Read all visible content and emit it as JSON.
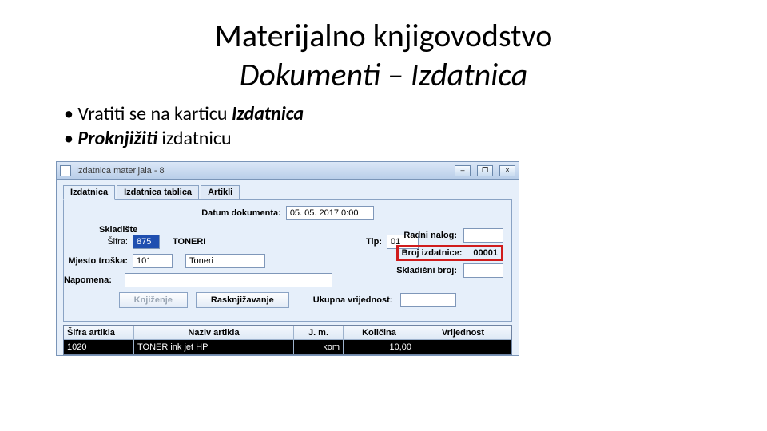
{
  "title": {
    "line1": "Materijalno knjigovodstvo",
    "line2": "Dokumenti – Izdatnica"
  },
  "bullets": {
    "b1_pre": "Vratiti se na karticu ",
    "b1_em": "Izdatnica",
    "b2_em": "Proknjižiti",
    "b2_post": " izdatnicu"
  },
  "app": {
    "window_title": "Izdatnica materijala - 8",
    "win_min": "–",
    "win_max": "❐",
    "win_close": "×",
    "tabs": {
      "t1": "Izdatnica",
      "t2": "Izdatnica tablica",
      "t3": "Artikli"
    },
    "fields": {
      "datum_lbl": "Datum dokumenta:",
      "datum_val": "05. 05. 2017 0:00",
      "skladiste_lbl": "Skladište",
      "sifra_lbl": "Šifra:",
      "sifra_val": "875",
      "sklad_name": "TONERI",
      "tip_lbl": "Tip:",
      "tip_val": "01",
      "mjesto_lbl": "Mjesto troška:",
      "mjesto_val": "101",
      "mjesto_name": "Toneri",
      "radni_lbl": "Radni nalog:",
      "napomena_lbl": "Napomena:",
      "broj_izd_lbl": "Broj izdatnice:",
      "broj_izd_val": "00001",
      "sklad_broj_lbl": "Skladišni broj:",
      "knj_btn": "Knjiženje",
      "rask_btn": "Rasknjižavanje",
      "ukupna_lbl": "Ukupna vrijednost:"
    },
    "grid": {
      "headers": {
        "h1": "Šifra artikla",
        "h2": "Naziv artikla",
        "h3": "J. m.",
        "h4": "Količina",
        "h5": "Vrijednost"
      },
      "row": {
        "c1": "1020",
        "c2": "TONER ink jet HP",
        "c3": "kom",
        "c4": "10,00",
        "c5": ""
      }
    }
  }
}
